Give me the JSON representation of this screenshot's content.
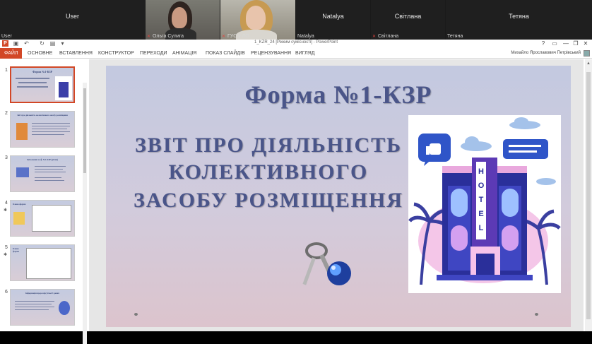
{
  "video_strip": {
    "tiles": [
      {
        "center": "User",
        "corner": "User"
      },
      {
        "center": "",
        "corner": "Ольга Сулига"
      },
      {
        "center": "",
        "corner": "ГУС у ЛО"
      },
      {
        "center": "Natalya",
        "corner": "Natalya"
      },
      {
        "center": "Світлана",
        "corner": "Світлана"
      },
      {
        "center": "Тетяна",
        "corner": "Тетяна"
      }
    ]
  },
  "window": {
    "title": "1_KZR_24 [Режим сумісності] - PowerPoint",
    "controls": [
      "?",
      "▭",
      "—",
      "❐",
      "✕"
    ]
  },
  "ribbon": {
    "tabs": [
      "ФАЙЛ",
      "ОСНОВНЕ",
      "ВСТАВЛЕННЯ",
      "КОНСТРУКТОР",
      "ПЕРЕХОДИ",
      "АНІМАЦІЯ",
      "ПОКАЗ СЛАЙДІВ",
      "РЕЦЕНЗУВАННЯ",
      "ВИГЛЯД"
    ],
    "user": "Михайло Ярославович Петрівський"
  },
  "thumbnails": [
    {
      "num": "1",
      "text": "Форма №1-КЗР"
    },
    {
      "num": "2",
      "text": "Звіт про діяльність колективного засобу розміщення"
    },
    {
      "num": "3",
      "text": "Звітування за ф. №1-КЗР (річна)"
    },
    {
      "num": "4",
      "text": "Бланк форми"
    },
    {
      "num": "5",
      "text": "Бланк форми"
    },
    {
      "num": "6",
      "text": "Інформація щодо відсутності даних"
    }
  ],
  "slide": {
    "title": "Форма №1-КЗР",
    "subtitle_lines": [
      "ЗВІТ  ПРО  ДІЯЛЬНІСТЬ",
      "КОЛЕКТИВНОГО",
      "ЗАСОБУ РОЗМІЩЕННЯ"
    ],
    "hotel_sign": [
      "H",
      "O",
      "T",
      "E",
      "L"
    ]
  },
  "colors": {
    "accent": "#d24726",
    "slide_text": "#4a5589"
  }
}
